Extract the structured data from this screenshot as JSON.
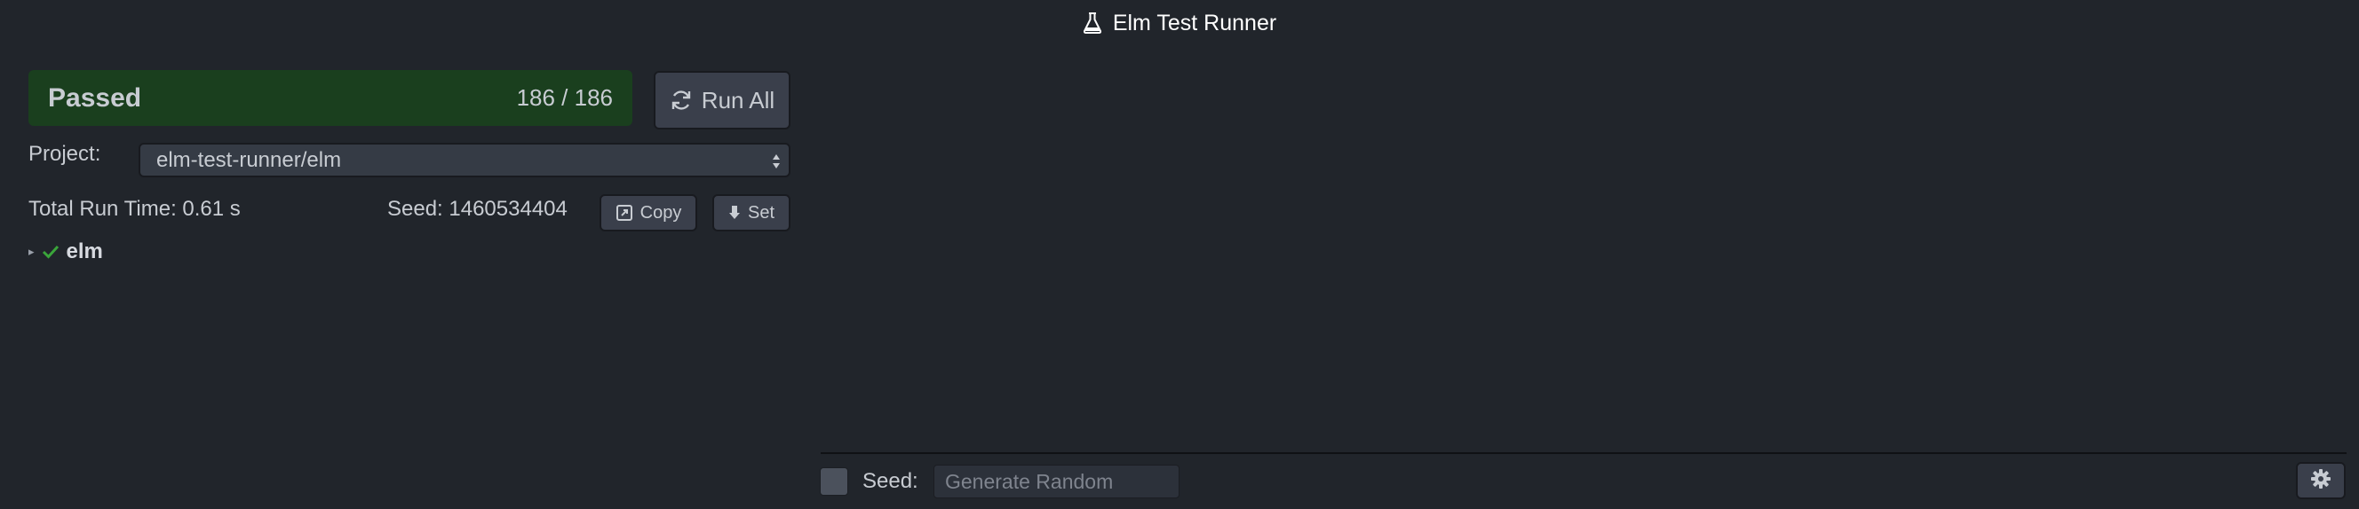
{
  "window": {
    "title": "Elm Test Runner",
    "title_icon": "flask-icon"
  },
  "status": {
    "label": "Passed",
    "count": "186 / 186",
    "color": "#1a3f1e"
  },
  "toolbar": {
    "run_all_label": "Run All",
    "run_all_icon": "refresh-icon"
  },
  "project": {
    "label": "Project:",
    "selected": "elm-test-runner/elm"
  },
  "run_info": {
    "runtime": "Total Run Time: 0.61 s",
    "seed": "Seed: 1460534404",
    "copy_label": "Copy",
    "copy_icon": "copy-icon",
    "set_label": "Set",
    "set_icon": "arrow-down-icon"
  },
  "tree": {
    "root": {
      "name": "elm",
      "status": "passed",
      "status_color": "#3aa53a"
    }
  },
  "footer": {
    "seed_label": "Seed:",
    "seed_placeholder": "Generate Random",
    "settings_icon": "gear-icon"
  }
}
